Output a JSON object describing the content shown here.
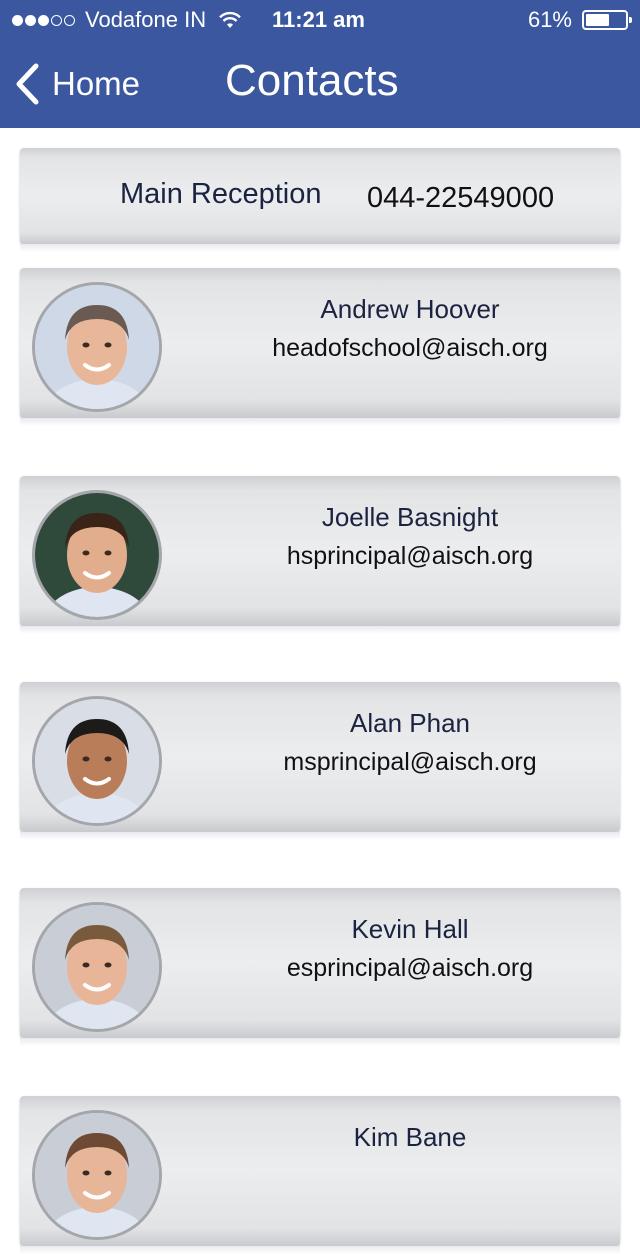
{
  "status_bar": {
    "carrier": "Vodafone IN",
    "time": "11:21 am",
    "battery_percent": "61%",
    "battery_level": 0.61,
    "signal_bars": 3,
    "signal_total": 5
  },
  "nav": {
    "back_label": "Home",
    "title": "Contacts",
    "bar_color": "#3b57a0"
  },
  "reception": {
    "label": "Main Reception",
    "phone": "044-22549000"
  },
  "contacts": [
    {
      "name": "Andrew Hoover",
      "email": "headofschool@aisch.org",
      "photo": "avatar-photo"
    },
    {
      "name": "Joelle Basnight",
      "email": "hsprincipal@aisch.org",
      "photo": "avatar-photo"
    },
    {
      "name": "Alan Phan",
      "email": "msprincipal@aisch.org",
      "photo": "avatar-photo"
    },
    {
      "name": "Kevin Hall",
      "email": "esprincipal@aisch.org",
      "photo": "avatar-photo"
    },
    {
      "name": "Kim Bane",
      "email": "",
      "photo": "avatar-photo"
    }
  ]
}
